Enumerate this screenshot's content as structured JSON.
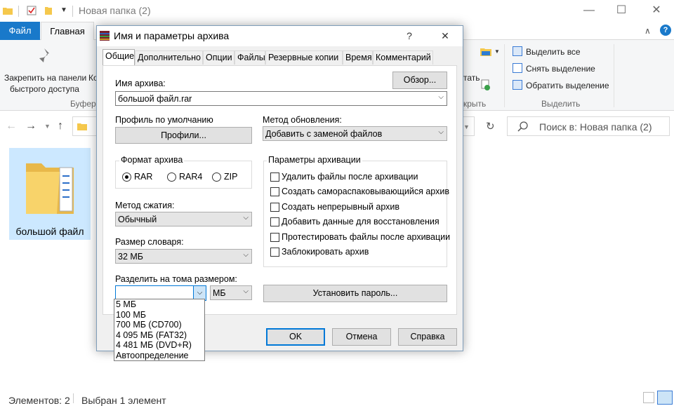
{
  "explorer": {
    "title": "Новая папка (2)",
    "tabs": {
      "file": "Файл",
      "home": "Главная"
    },
    "ribbon": {
      "pin_line1": "Закрепить на панели",
      "pin_line2": "быстрого доступа",
      "pin_trunc": "Ко",
      "clipboard_group": "Буфер",
      "open_group_partial": "крыть",
      "select_all": "Выделить все",
      "deselect": "Снять выделение",
      "invert": "Обратить выделение",
      "select_group": "Выделить"
    },
    "search_placeholder": "Поиск в: Новая папка (2)",
    "folder_name": "большой файл",
    "status": {
      "items": "Элементов: 2",
      "selected": "Выбран 1 элемент"
    }
  },
  "dialog": {
    "title": "Имя и параметры архива",
    "help": "?",
    "close": "✕",
    "tabs": [
      "Общие",
      "Дополнительно",
      "Опции",
      "Файлы",
      "Резервные копии",
      "Время",
      "Комментарий"
    ],
    "archive_name_label": "Имя архива:",
    "archive_name_value": "большой файл.rar",
    "browse_button": "Обзор...",
    "profile_label": "Профиль по умолчанию",
    "profiles_button": "Профили...",
    "update_method_label": "Метод обновления:",
    "update_method_value": "Добавить с заменой файлов",
    "format_label": "Формат архива",
    "formats": [
      "RAR",
      "RAR4",
      "ZIP"
    ],
    "format_selected": "RAR",
    "options_label": "Параметры архивации",
    "options": [
      "Удалить файлы после архивации",
      "Создать самораспаковывающийся архив",
      "Создать непрерывный архив",
      "Добавить данные для восстановления",
      "Протестировать файлы после архивации",
      "Заблокировать архив"
    ],
    "compression_label": "Метод сжатия:",
    "compression_value": "Обычный",
    "dict_label": "Размер словаря:",
    "dict_value": "32 МБ",
    "split_label": "Разделить на тома размером:",
    "split_value": "",
    "split_unit": "МБ",
    "split_options": [
      "5 МБ",
      "100 МБ",
      "700 МБ  (CD700)",
      "4 095 МБ  (FAT32)",
      "4 481 МБ  (DVD+R)",
      "Автоопределение"
    ],
    "password_button": "Установить пароль...",
    "ok": "OK",
    "cancel": "Отмена",
    "help_button": "Справка"
  }
}
